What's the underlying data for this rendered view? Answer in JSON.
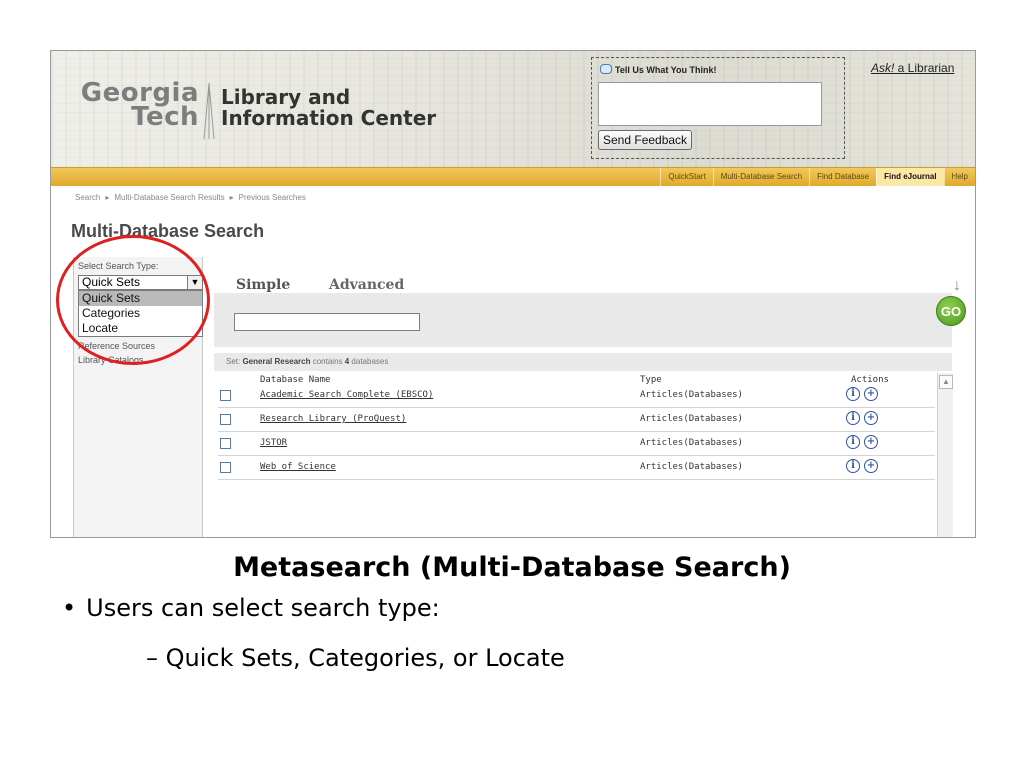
{
  "banner": {
    "logo_line1": "Georgia",
    "logo_line2": "Tech",
    "library_line1": "Library and",
    "library_line2": "Information Center"
  },
  "feedback": {
    "title": "Tell Us What You Think!",
    "button_label": "Send Feedback"
  },
  "ask": {
    "ask_em": "Ask!",
    "rest": " a Librarian"
  },
  "nav": {
    "items": [
      "QuickStart",
      "Multi-Database Search",
      "Find Database",
      "Find eJournal",
      "Help"
    ],
    "active_index": 3
  },
  "breadcrumb": [
    "Search",
    "Multi-Database Search Results",
    "Previous Searches"
  ],
  "page_title": "Multi-Database Search",
  "sidebar": {
    "label": "Select Search Type:",
    "selected": "Quick Sets",
    "options": [
      "Quick Sets",
      "Categories",
      "Locate"
    ],
    "extra_items": [
      "Reference Sources",
      "Library Catalogs"
    ]
  },
  "tabs": {
    "simple": "Simple",
    "advanced": "Advanced"
  },
  "go_label": "GO",
  "set_info": {
    "prefix": "Set: ",
    "name": "General Research",
    "suffix": " contains ",
    "count": "4",
    "tail": " databases"
  },
  "table": {
    "headers": {
      "name": "Database Name",
      "type": "Type",
      "actions": "Actions"
    },
    "rows": [
      {
        "name": "Academic Search Complete (EBSCO)",
        "type": "Articles(Databases)"
      },
      {
        "name": "Research Library (ProQuest)",
        "type": "Articles(Databases)"
      },
      {
        "name": "JSTOR",
        "type": "Articles(Databases)"
      },
      {
        "name": "Web of Science",
        "type": "Articles(Databases)"
      }
    ]
  },
  "slide": {
    "title": "Metasearch (Multi-Database Search)",
    "bullet": "Users can select search type:",
    "sub_bullet": "– Quick Sets, Categories, or Locate"
  },
  "colors": {
    "nav_gold": "#e0aa2a",
    "highlight_ring": "#e02020",
    "go_green": "#4b9a20"
  }
}
